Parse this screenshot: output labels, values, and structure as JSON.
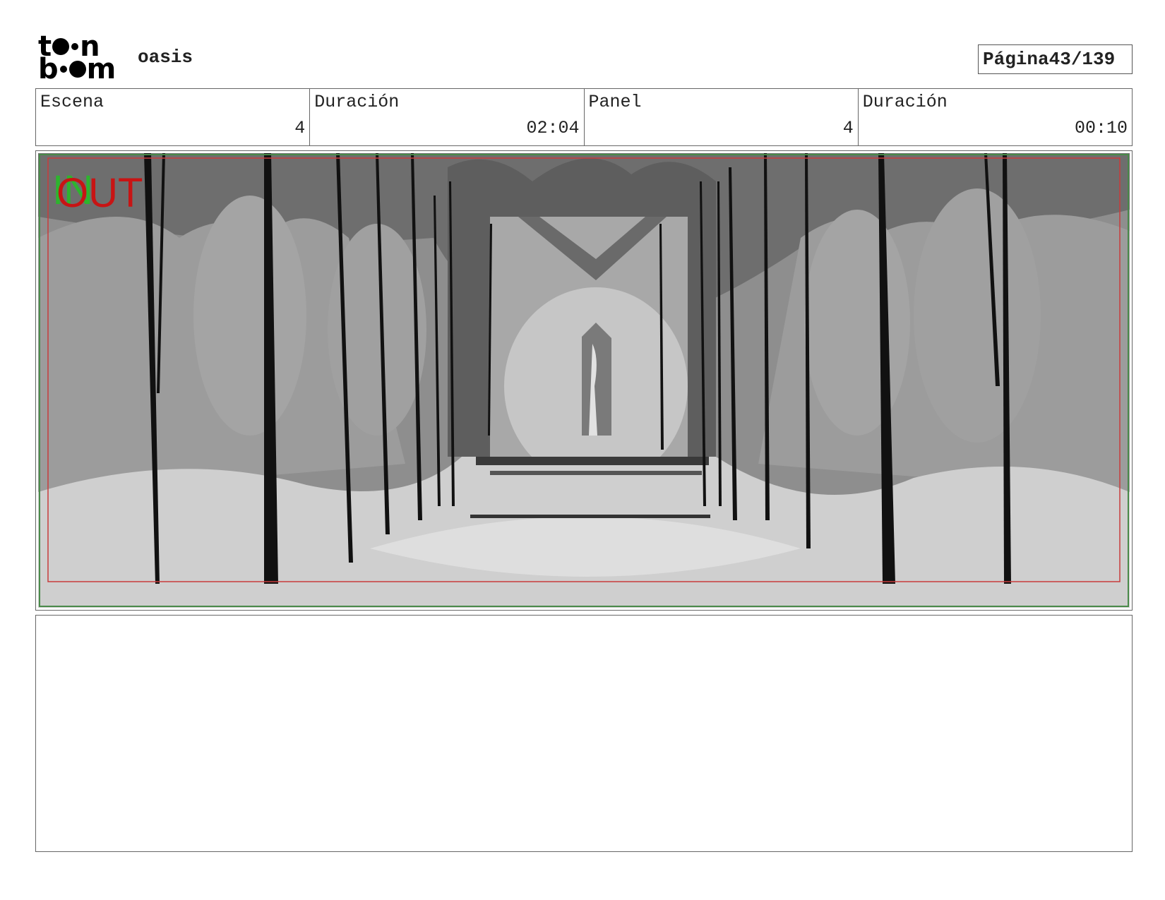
{
  "header": {
    "logo": {
      "line1": [
        "t",
        "n"
      ],
      "line2": [
        "b",
        "m"
      ]
    },
    "project_name": "oasis",
    "page_label": "Página",
    "page_value": "43/139"
  },
  "info": [
    {
      "label": "Escena",
      "value": "4"
    },
    {
      "label": "Duración",
      "value": "02:04"
    },
    {
      "label": "Panel",
      "value": "4"
    },
    {
      "label": "Duración",
      "value": "00:10"
    }
  ],
  "panel": {
    "in_marker": "IN",
    "out_marker": "OUT",
    "colors": {
      "in": "#2db52d",
      "out": "#c81414",
      "safe_frame": "#c83c3c",
      "outer_frame": "#4a8a4a"
    }
  },
  "notes": {
    "text": ""
  }
}
